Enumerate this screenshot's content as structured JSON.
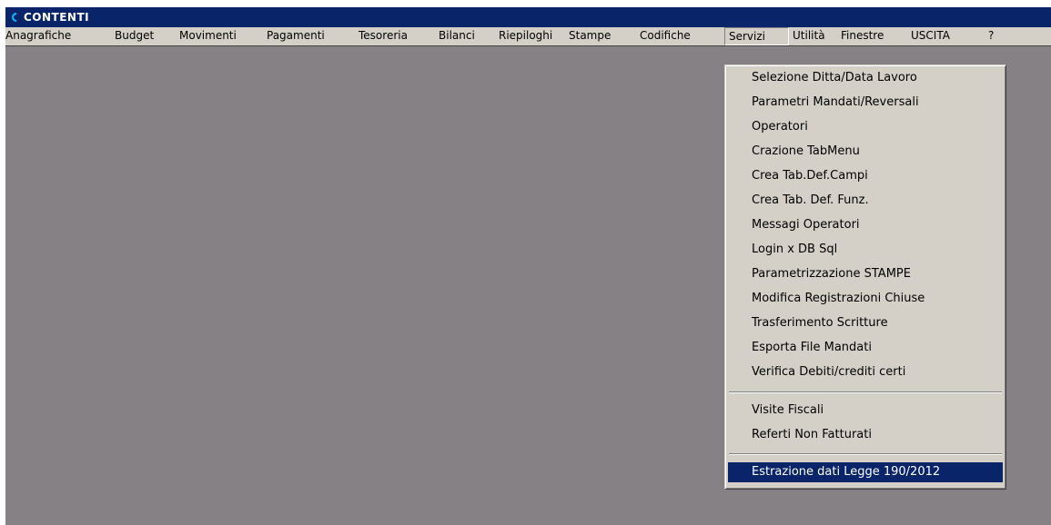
{
  "window": {
    "title": "CONTENTI"
  },
  "menubar": {
    "items": [
      {
        "label": "Anagrafiche"
      },
      {
        "label": "Budget"
      },
      {
        "label": "Movimenti"
      },
      {
        "label": "Pagamenti"
      },
      {
        "label": "Tesoreria"
      },
      {
        "label": "Bilanci"
      },
      {
        "label": "Riepiloghi"
      },
      {
        "label": "Stampe"
      },
      {
        "label": "Codifiche"
      },
      {
        "label": "Servizi"
      },
      {
        "label": "Utilità"
      },
      {
        "label": "Finestre"
      },
      {
        "label": "USCITA"
      },
      {
        "label": "?"
      }
    ],
    "active": "Servizi"
  },
  "servizi_menu": {
    "group1": [
      {
        "label": "Selezione Ditta/Data Lavoro"
      },
      {
        "label": "Parametri Mandati/Reversali"
      },
      {
        "label": "Operatori"
      },
      {
        "label": "Crazione TabMenu"
      },
      {
        "label": "Crea Tab.Def.Campi"
      },
      {
        "label": "Crea Tab. Def. Funz."
      },
      {
        "label": "Messagi Operatori"
      },
      {
        "label": "Login x DB Sql"
      },
      {
        "label": "Parametrizzazione STAMPE"
      },
      {
        "label": "Modifica Registrazioni Chiuse"
      },
      {
        "label": "Trasferimento Scritture"
      },
      {
        "label": "Esporta File Mandati"
      },
      {
        "label": "Verifica Debiti/crediti certi"
      }
    ],
    "group2": [
      {
        "label": "Visite Fiscali"
      },
      {
        "label": "Referti Non Fatturati"
      }
    ],
    "group3": [
      {
        "label": "Estrazione dati Legge 190/2012"
      }
    ],
    "selected": "Estrazione dati Legge 190/2012"
  },
  "colors": {
    "titlebar": "#0a246a",
    "menu_face": "#d4d0c8",
    "mdi_background": "#858185",
    "highlight": "#0a246a",
    "highlight_text": "#ffffff"
  }
}
